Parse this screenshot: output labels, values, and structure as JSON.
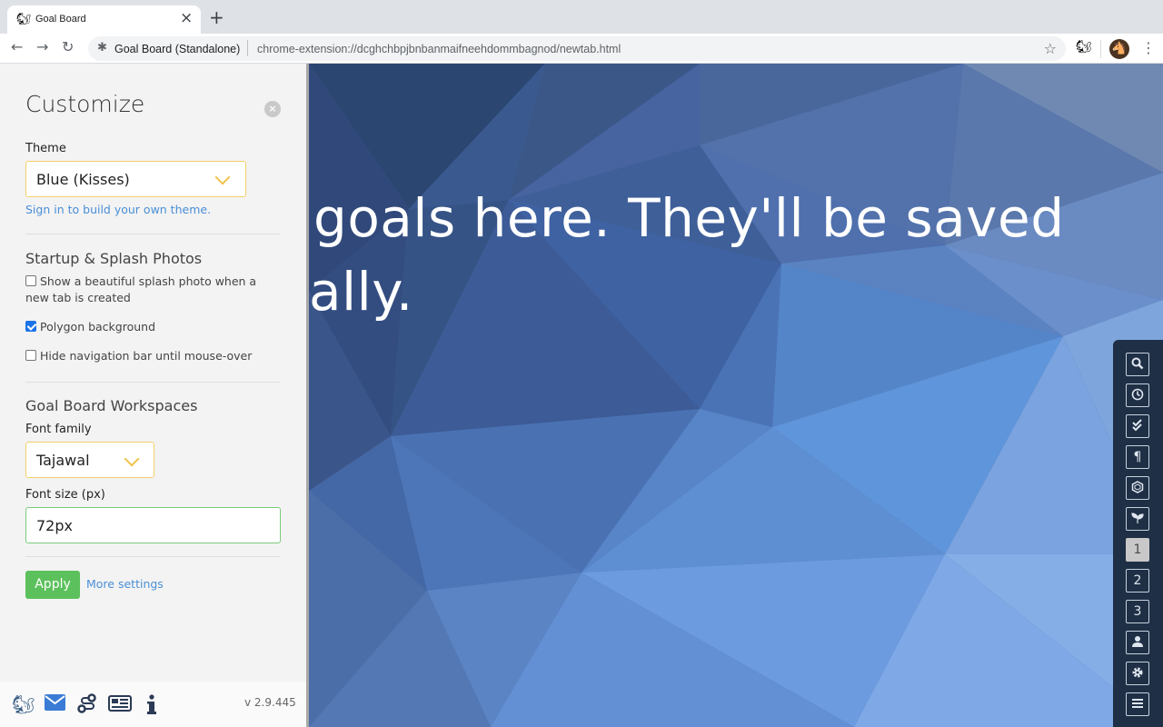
{
  "browser": {
    "tab_title": "Goal Board",
    "tab_close": "×",
    "new_tab": "+",
    "site_name": "Goal Board (Standalone)",
    "url": "chrome-extension://dcghchbpjbnbanmaifneehdommbagnod/newtab.html",
    "nav": {
      "back": "←",
      "forward": "→",
      "reload": "↻"
    },
    "star": "☆",
    "menu": "⋮"
  },
  "hero": {
    "line1": "goals here. They'll be saved",
    "line2": "ally."
  },
  "panel": {
    "title": "Customize",
    "close": "×",
    "theme_label": "Theme",
    "theme_value": "Blue (Kisses)",
    "theme_link": "Sign in to build your own theme.",
    "startup_section": "Startup & Splash Photos",
    "options": [
      {
        "label": "Show a beautiful splash photo when a new tab is created",
        "checked": false
      },
      {
        "label": "Polygon background",
        "checked": true
      },
      {
        "label": "Hide navigation bar until mouse-over",
        "checked": false
      }
    ],
    "workspaces_section": "Goal Board Workspaces",
    "font_family_label": "Font family",
    "font_family_value": "Tajawal",
    "font_size_label": "Font size (px)",
    "font_size_value": "72px",
    "apply_label": "Apply",
    "more_settings": "More settings",
    "version": "v 2.9.445"
  },
  "footer_icons": [
    "squirrel-icon",
    "mail-icon",
    "route-icon",
    "newspaper-icon",
    "info-icon"
  ],
  "dock": {
    "icons": [
      "search-icon",
      "clock-icon",
      "double-check-icon",
      "paragraph-icon",
      "hexagon-icon",
      "seedling-icon"
    ],
    "workspaces": [
      "1",
      "2",
      "3"
    ],
    "active_workspace": "1",
    "bottom_icons": [
      "user-icon",
      "gear-icon",
      "menu-icon"
    ]
  },
  "colors": {
    "accent_link": "#4a8fd6",
    "apply_green": "#5cc15c",
    "dock_bg": "#1f2f45",
    "select_border": "#f5d06a"
  }
}
